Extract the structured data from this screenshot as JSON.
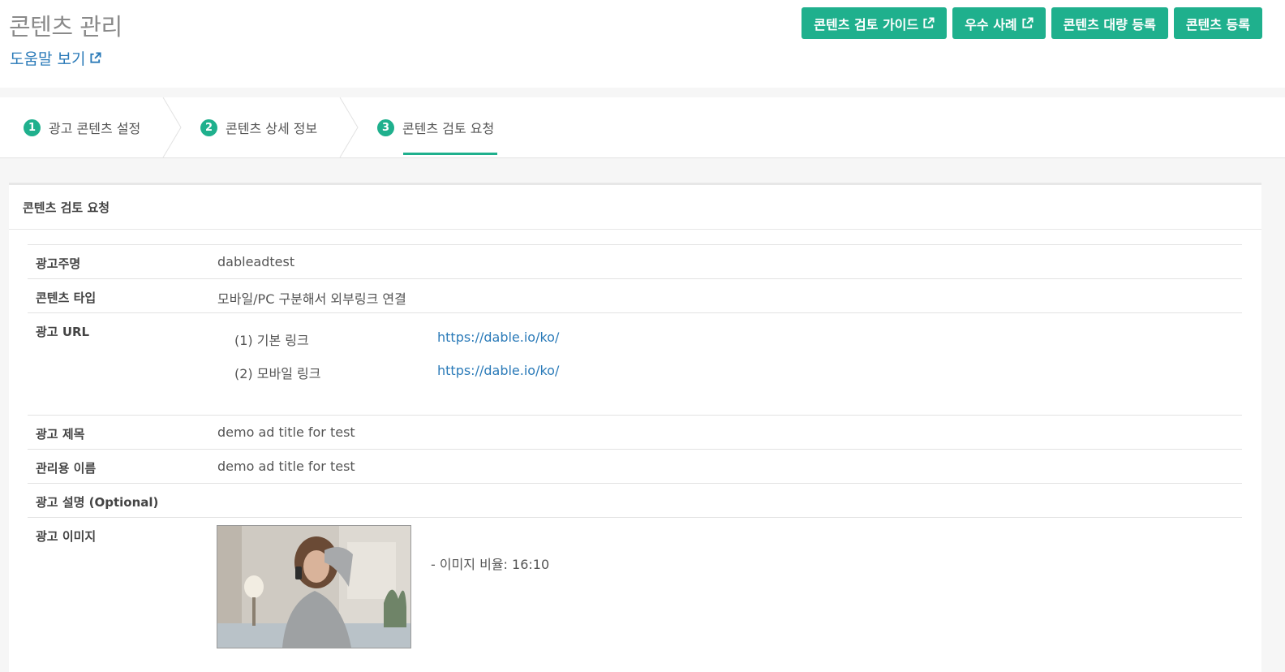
{
  "header": {
    "title": "콘텐츠 관리",
    "help_link": "도움말 보기"
  },
  "actions": {
    "review_guide": "콘텐츠 검토 가이드",
    "best_cases": "우수 사례",
    "bulk_register": "콘텐츠 대량 등록",
    "register": "콘텐츠 등록"
  },
  "steps": [
    {
      "num": "1",
      "label": "광고 콘텐츠 설정"
    },
    {
      "num": "2",
      "label": "콘텐츠 상세 정보"
    },
    {
      "num": "3",
      "label": "콘텐츠 검토 요청"
    }
  ],
  "active_step": 3,
  "panel": {
    "title": "콘텐츠 검토 요청",
    "rows": {
      "advertiser": {
        "label": "광고주명",
        "value": "dableadtest"
      },
      "content_type": {
        "label": "콘텐츠 타입",
        "value": "모바일/PC 구분해서 외부링크 연결"
      },
      "ad_url": {
        "label": "광고 URL",
        "links": [
          {
            "name": "(1) 기본 링크",
            "url": "https://dable.io/ko/"
          },
          {
            "name": "(2) 모바일 링크",
            "url": "https://dable.io/ko/"
          }
        ]
      },
      "ad_title": {
        "label": "광고 제목",
        "value": "demo ad title for test"
      },
      "admin_name": {
        "label": "관리용 이름",
        "value": "demo ad title for test"
      },
      "ad_description": {
        "label": "광고 설명 (Optional)",
        "value": ""
      },
      "ad_image": {
        "label": "광고 이미지",
        "ratio": "- 이미지 비율: 16:10"
      }
    }
  },
  "colors": {
    "accent": "#1fb08d",
    "link": "#2a7ab8"
  }
}
